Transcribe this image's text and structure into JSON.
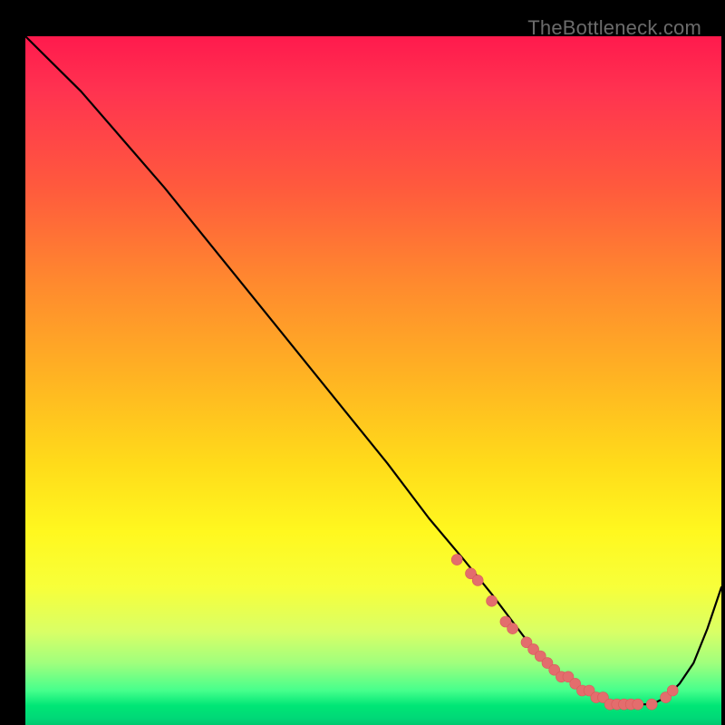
{
  "watermark": "TheBottleneck.com",
  "colors": {
    "background": "#000000",
    "curve": "#000000",
    "dot": "#e36d6d",
    "gradient_top": "#ff1a4d",
    "gradient_bottom": "#00c76f"
  },
  "chart_data": {
    "type": "line",
    "title": "",
    "xlabel": "",
    "ylabel": "",
    "xlim": [
      0,
      100
    ],
    "ylim": [
      0,
      100
    ],
    "curve": {
      "x": [
        0,
        3,
        8,
        14,
        20,
        28,
        36,
        44,
        52,
        58,
        63,
        67,
        70,
        73,
        76,
        79,
        82,
        85,
        88,
        90,
        92,
        94,
        96,
        98,
        100
      ],
      "y": [
        100,
        97,
        92,
        85,
        78,
        68,
        58,
        48,
        38,
        30,
        24,
        19,
        15,
        11,
        8,
        6,
        4,
        3,
        3,
        3,
        4,
        6,
        9,
        14,
        20
      ]
    },
    "dots": {
      "x": [
        62,
        64,
        65,
        67,
        69,
        70,
        72,
        73,
        74,
        75,
        76,
        77,
        78,
        79,
        80,
        81,
        82,
        83,
        84,
        85,
        86,
        87,
        88,
        90,
        92,
        93
      ],
      "y": [
        24,
        22,
        21,
        18,
        15,
        14,
        12,
        11,
        10,
        9,
        8,
        7,
        7,
        6,
        5,
        5,
        4,
        4,
        3,
        3,
        3,
        3,
        3,
        3,
        4,
        5
      ]
    }
  }
}
